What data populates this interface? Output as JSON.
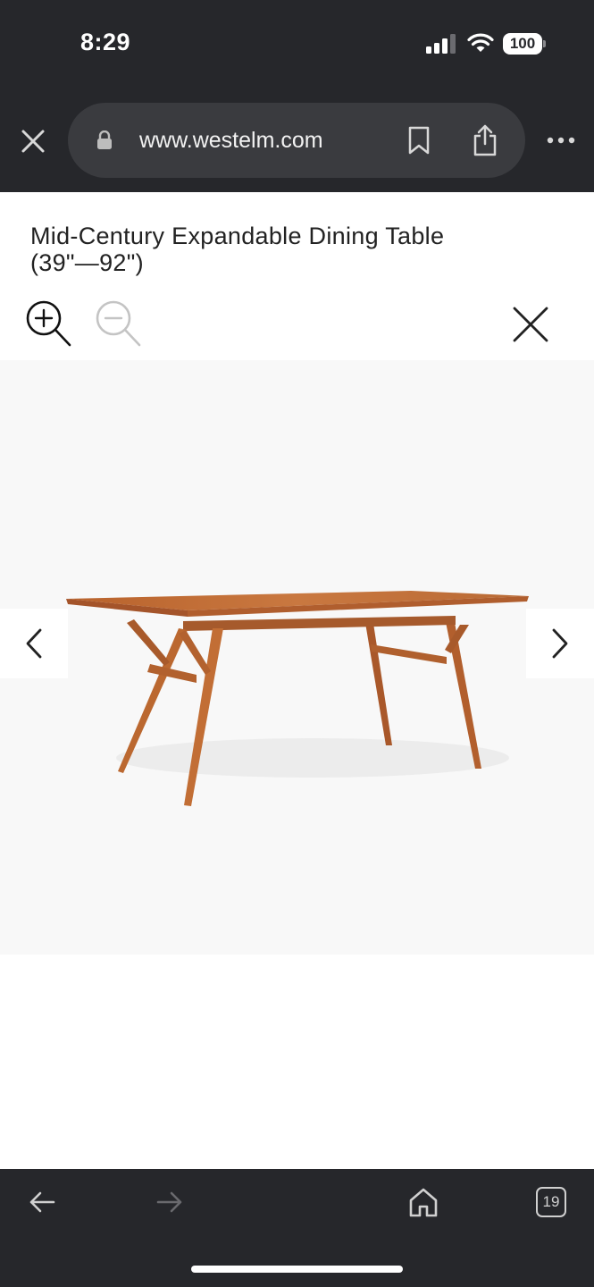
{
  "status_bar": {
    "time": "8:29",
    "battery": "100"
  },
  "browser": {
    "url": "www.westelm.com",
    "tab_count": "19"
  },
  "product": {
    "title": "Mid-Century Expandable Dining Table (39\"—92\")"
  },
  "icons": {
    "tab_close": "close-icon",
    "lock": "lock-icon",
    "bookmark": "bookmark-icon",
    "share": "share-icon",
    "more": "more-icon",
    "zoom_in": "zoom-in-icon",
    "zoom_out": "zoom-out-icon",
    "modal_close": "close-icon",
    "prev": "chevron-left-icon",
    "next": "chevron-right-icon",
    "back": "arrow-left-icon",
    "forward": "arrow-right-icon",
    "home": "home-icon"
  },
  "colors": {
    "chrome_bg": "#26272b",
    "url_pill_bg": "#3a3b3f",
    "image_bg": "#f8f8f8",
    "wood": "#c4713a"
  }
}
